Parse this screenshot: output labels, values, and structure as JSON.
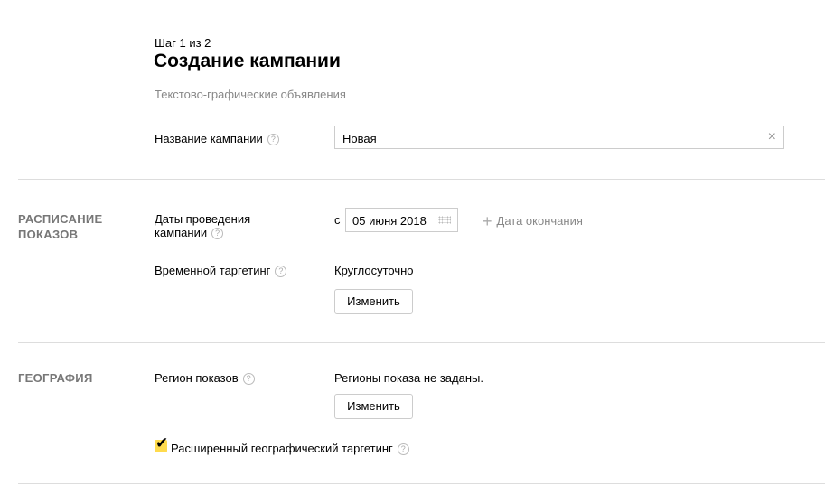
{
  "header": {
    "step": "Шаг 1 из 2",
    "title": "Создание кампании",
    "subtitle": "Текстово-графические объявления"
  },
  "name_field": {
    "label": "Название кампании",
    "value": "Новая"
  },
  "schedule": {
    "section_title": "РАСПИСАНИЕ ПОКАЗОВ",
    "dates_label": "Даты проведения кампании",
    "from_prefix": "с",
    "start_date": "05 июня 2018",
    "end_date_link": "Дата окончания",
    "time_label": "Временной таргетинг",
    "time_value": "Круглосуточно",
    "change_label": "Изменить"
  },
  "geo": {
    "section_title": "ГЕОГРАФИЯ",
    "region_label": "Регион показов",
    "region_value": "Регионы показа не заданы.",
    "change_label": "Изменить",
    "extended_label": "Расширенный географический таргетинг",
    "extended_checked": true
  },
  "help_glyph": "?",
  "colors": {
    "checkbox": "#ffdb4d"
  }
}
